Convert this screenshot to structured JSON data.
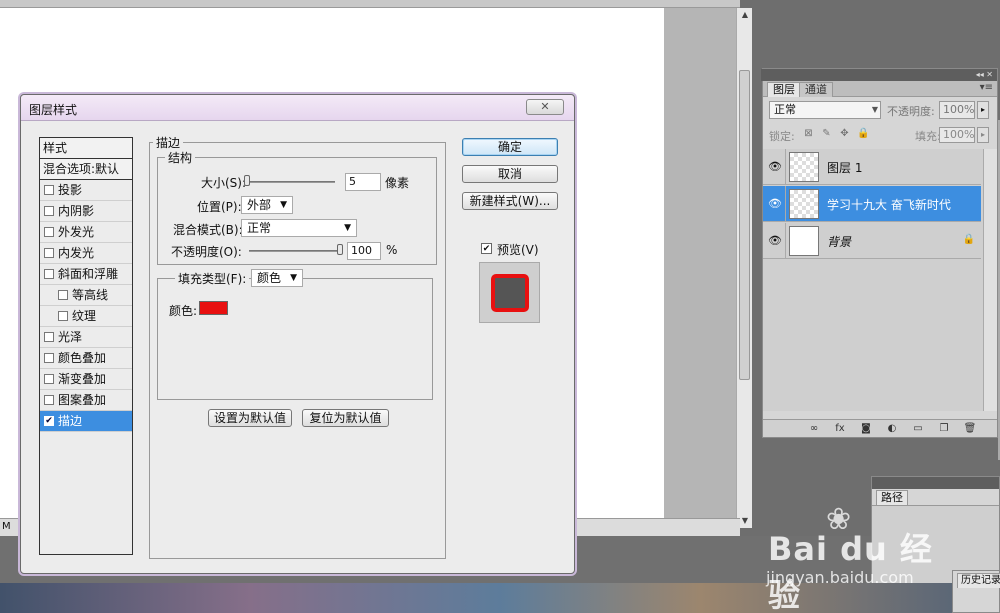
{
  "document": {
    "status_text": "M"
  },
  "layers_panel": {
    "tabs": [
      {
        "label": "图层",
        "active": true
      },
      {
        "label": "通道",
        "active": false
      }
    ],
    "blend_mode": "正常",
    "opacity_label": "不透明度:",
    "opacity_value": "100%",
    "lock_label": "锁定:",
    "fill_label": "填充:",
    "fill_value": "100%",
    "layers": [
      {
        "name": "图层 1",
        "visible": true,
        "selected": false,
        "thumb": "checker"
      },
      {
        "name": "学习十九大 奋飞新时代",
        "visible": true,
        "selected": true,
        "thumb": "checker"
      },
      {
        "name": "背景",
        "visible": true,
        "selected": false,
        "thumb": "white",
        "locked": true
      }
    ],
    "bottom_icons": [
      "link-icon",
      "fx-icon",
      "mask-icon",
      "adjustment-icon",
      "group-icon",
      "new-layer-icon",
      "trash-icon"
    ]
  },
  "paths_panel": {
    "tab_label": "路径"
  },
  "history_panel": {
    "tab_label": "历史记录"
  },
  "dialog": {
    "title": "图层样式",
    "close_label": "✕",
    "style_list": {
      "header": "样式",
      "blend_options": "混合选项:默认",
      "items": [
        {
          "label": "投影",
          "checked": false,
          "indent": false
        },
        {
          "label": "内阴影",
          "checked": false,
          "indent": false
        },
        {
          "label": "外发光",
          "checked": false,
          "indent": false
        },
        {
          "label": "内发光",
          "checked": false,
          "indent": false
        },
        {
          "label": "斜面和浮雕",
          "checked": false,
          "indent": false
        },
        {
          "label": "等高线",
          "checked": false,
          "indent": true
        },
        {
          "label": "纹理",
          "checked": false,
          "indent": true
        },
        {
          "label": "光泽",
          "checked": false,
          "indent": false
        },
        {
          "label": "颜色叠加",
          "checked": false,
          "indent": false
        },
        {
          "label": "渐变叠加",
          "checked": false,
          "indent": false
        },
        {
          "label": "图案叠加",
          "checked": false,
          "indent": false
        },
        {
          "label": "描边",
          "checked": true,
          "indent": false,
          "selected": true
        }
      ]
    },
    "stroke": {
      "group_title": "描边",
      "structure_title": "结构",
      "size_label": "大小(S):",
      "size_value": "5",
      "size_unit": "像素",
      "position_label": "位置(P):",
      "position_value": "外部",
      "blend_label": "混合模式(B):",
      "blend_value": "正常",
      "opacity_label": "不透明度(O):",
      "opacity_value": "100",
      "opacity_unit": "%",
      "fill_type_label": "填充类型(F):",
      "fill_type_value": "颜色",
      "color_label": "颜色:",
      "stroke_color": "#e81010",
      "size_slider_fraction": 0.02,
      "opacity_slider_fraction": 1.0,
      "set_default_label": "设置为默认值",
      "reset_default_label": "复位为默认值"
    },
    "buttons": {
      "ok": "确定",
      "cancel": "取消",
      "new_style": "新建样式(W)..."
    },
    "preview": {
      "label": "预览(V)",
      "checked": true
    }
  },
  "watermark": {
    "brand": "Bai du 经验",
    "site": "jingyan.baidu.com"
  }
}
